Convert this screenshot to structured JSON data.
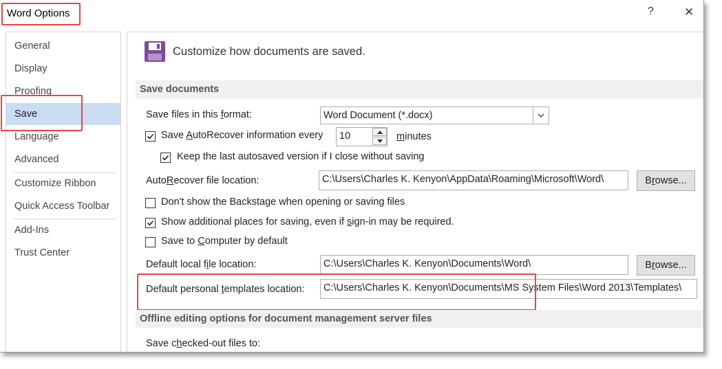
{
  "window": {
    "title": "Word Options",
    "help_label": "?",
    "close_label": "✕"
  },
  "sidebar": {
    "items": [
      {
        "label": "General"
      },
      {
        "label": "Display"
      },
      {
        "label": "Proofing"
      },
      {
        "label": "Save"
      },
      {
        "label": "Language"
      },
      {
        "label": "Advanced"
      },
      {
        "label": "Customize Ribbon"
      },
      {
        "label": "Quick Access Toolbar"
      },
      {
        "label": "Add-Ins"
      },
      {
        "label": "Trust Center"
      }
    ],
    "selected": "Save"
  },
  "main": {
    "header": "Customize how documents are saved.",
    "icon": "save-floppy-icon",
    "sections": {
      "save_documents": "Save documents",
      "offline": "Offline editing options for document management server files"
    },
    "format_label": "Save files in this format:",
    "format_value": "Word Document (*.docx)",
    "autorecover_label": "Save AutoRecover information every",
    "autorecover_checked": true,
    "autorecover_minutes": "10",
    "minutes_label": "minutes",
    "keep_last_label": "Keep the last autosaved version if I close without saving",
    "keep_last_checked": true,
    "autorecover_location_label": "AutoRecover file location:",
    "autorecover_location_value": "C:\\Users\\Charles K. Kenyon\\AppData\\Roaming\\Microsoft\\Word\\",
    "browse_label": "Browse...",
    "backstage_label": "Don't show the Backstage when opening or saving files",
    "backstage_checked": false,
    "additional_places_label": "Show additional places for saving, even if sign-in may be required.",
    "additional_places_checked": true,
    "save_to_computer_label": "Save to Computer by default",
    "save_to_computer_checked": false,
    "default_local_label": "Default local file location:",
    "default_local_value": "C:\\Users\\Charles K. Kenyon\\Documents\\Word\\",
    "templates_label": "Default personal templates location:",
    "templates_value": "C:\\Users\\Charles K. Kenyon\\Documents\\MS System Files\\Word 2013\\Templates\\",
    "checked_out_label": "Save checked-out files to:"
  },
  "colors": {
    "highlight": "#e64545",
    "selected_nav": "#c9dcf2",
    "icon_purple": "#7e4a9b"
  }
}
